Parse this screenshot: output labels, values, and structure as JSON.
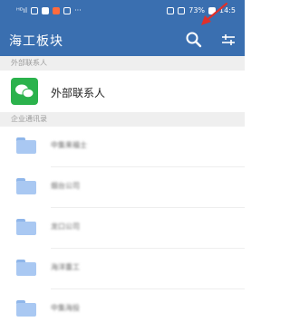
{
  "status_bar": {
    "left_text": "ᴴᴰıl",
    "more": "···",
    "battery": "73%",
    "time": "14:5"
  },
  "header": {
    "title": "海工板块",
    "search_icon": "search-icon",
    "filter_icon": "filter-icon"
  },
  "sections": {
    "external": {
      "label": "外部联系人"
    },
    "org": {
      "label": "企业通讯录"
    }
  },
  "external_contact": {
    "label": "外部联系人",
    "icon": "wechat-icon"
  },
  "org_items": [
    {
      "name": "中集来福士"
    },
    {
      "name": "烟台公司"
    },
    {
      "name": "龙口公司"
    },
    {
      "name": "海洋重工"
    },
    {
      "name": "中集海投"
    }
  ],
  "colors": {
    "header_bg": "#3a6fb0",
    "wechat_green": "#2bb24c",
    "folder_blue": "#a9c8f2",
    "annotation_arrow": "#e0302a"
  }
}
